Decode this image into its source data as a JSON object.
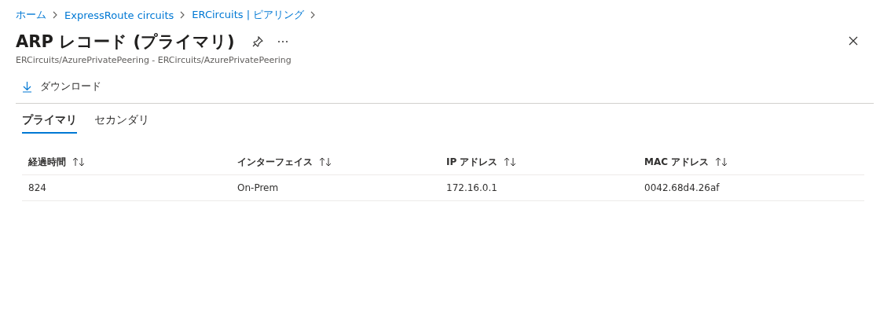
{
  "breadcrumb": [
    "ホーム",
    "ExpressRoute circuits",
    "ERCircuits | ピアリング"
  ],
  "title": "ARP レコード (プライマリ)",
  "subtitle": "ERCircuits/AzurePrivatePeering - ERCircuits/AzurePrivatePeering",
  "toolbar": [
    {
      "label": "ダウンロード"
    }
  ],
  "tabs": [
    {
      "label": "プライマリ",
      "selected": true
    },
    {
      "label": "セカンダリ",
      "selected": false
    }
  ],
  "table": {
    "columns": [
      "経過時間",
      "インターフェイス",
      "IP アドレス",
      "MAC アドレス"
    ],
    "rows": [
      [
        "824",
        "On-Prem",
        "172.16.0.1",
        "0042.68d4.26af"
      ]
    ]
  }
}
